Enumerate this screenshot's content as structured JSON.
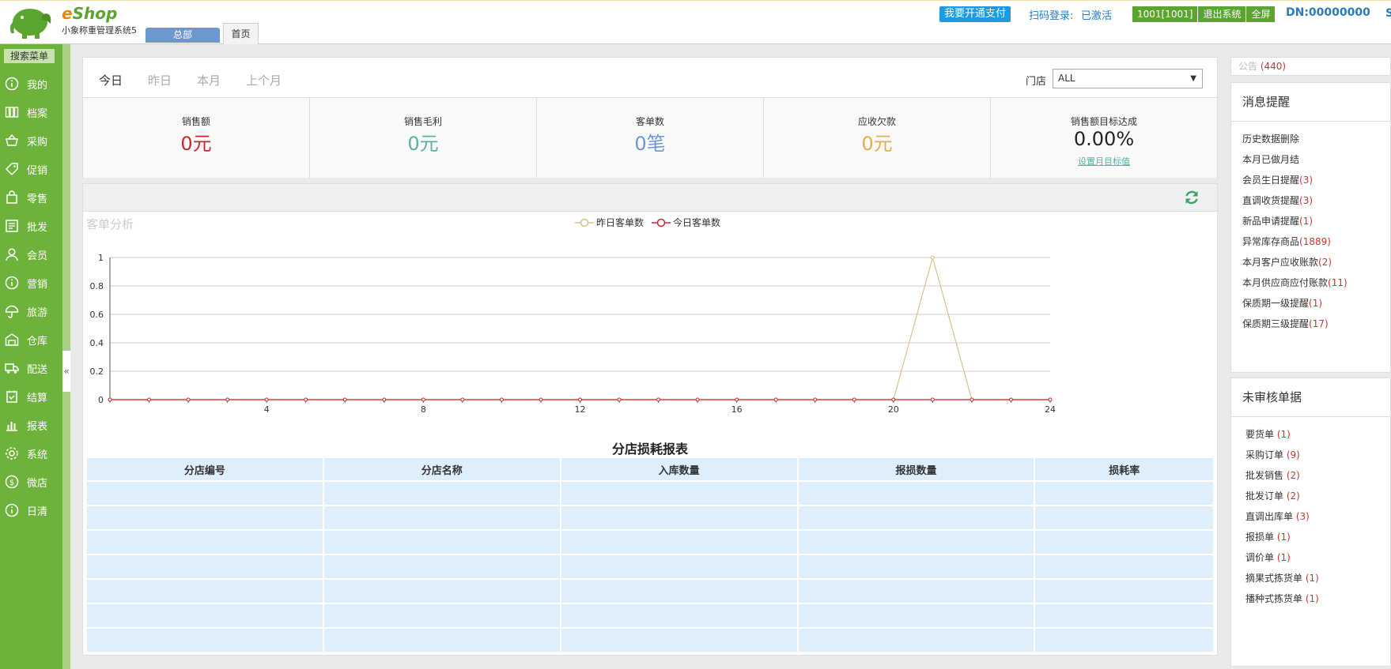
{
  "header": {
    "brand_e": "e",
    "brand_rest": "Shop",
    "subtitle": "小象称重管理系统5",
    "hq_button": "总部",
    "home_tab": "首页",
    "pay_button": "我要开通支付",
    "scan_label": "扫码登录:",
    "scan_status": "已激活",
    "user": "1001[1001]",
    "logout": "退出系统",
    "fullscreen": "全屏",
    "dn": "DN:00000000",
    "edge_char": "S"
  },
  "sidebar": {
    "search_menu": "搜索菜单",
    "collapse": "«",
    "items": [
      {
        "label": "我的",
        "icon": "info-icon"
      },
      {
        "label": "档案",
        "icon": "archive-icon"
      },
      {
        "label": "采购",
        "icon": "basket-icon"
      },
      {
        "label": "促销",
        "icon": "tag-icon"
      },
      {
        "label": "零售",
        "icon": "bag-icon"
      },
      {
        "label": "批发",
        "icon": "wholesale-icon"
      },
      {
        "label": "会员",
        "icon": "user-icon"
      },
      {
        "label": "营销",
        "icon": "info-icon"
      },
      {
        "label": "旅游",
        "icon": "umbrella-icon"
      },
      {
        "label": "仓库",
        "icon": "warehouse-icon"
      },
      {
        "label": "配送",
        "icon": "truck-icon"
      },
      {
        "label": "结算",
        "icon": "settle-icon"
      },
      {
        "label": "报表",
        "icon": "chart-icon"
      },
      {
        "label": "系统",
        "icon": "gear-icon"
      },
      {
        "label": "微店",
        "icon": "shop-icon"
      },
      {
        "label": "日清",
        "icon": "info-icon"
      }
    ]
  },
  "main": {
    "date_tabs": [
      "今日",
      "昨日",
      "本月",
      "上个月"
    ],
    "active_tab": 0,
    "store_label": "门店",
    "store_value": "ALL",
    "stats": [
      {
        "label": "销售额",
        "value": "0元",
        "color": "#c8282d"
      },
      {
        "label": "销售毛利",
        "value": "0元",
        "color": "#5cb0a0"
      },
      {
        "label": "客单数",
        "value": "0笔",
        "color": "#6c98cf"
      },
      {
        "label": "应收欠款",
        "value": "0元",
        "color": "#e0b050"
      },
      {
        "label": "销售额目标达成",
        "value": "0.00%",
        "color": "#222222",
        "link": "设置月目标值"
      }
    ]
  },
  "chart": {
    "title": "客单分析",
    "legend": [
      "昨日客单数",
      "今日客单数"
    ],
    "table_title": "分店损耗报表",
    "table_headers": [
      "分店编号",
      "分店名称",
      "入库数量",
      "报损数量",
      "损耗率"
    ],
    "empty_rows": 7
  },
  "chart_data": {
    "type": "line",
    "title": "客单分析",
    "x": [
      0,
      1,
      2,
      3,
      4,
      5,
      6,
      7,
      8,
      9,
      10,
      11,
      12,
      13,
      14,
      15,
      16,
      17,
      18,
      19,
      20,
      21,
      22,
      23,
      24
    ],
    "xticks": [
      4,
      8,
      12,
      16,
      20,
      24
    ],
    "ylim": [
      0,
      1
    ],
    "yticks": [
      0,
      0.2,
      0.4,
      0.6,
      0.8,
      1
    ],
    "grid": true,
    "legend_position": "top-center",
    "series": [
      {
        "name": "昨日客单数",
        "color": "#d9c28a",
        "values": [
          0,
          0,
          0,
          0,
          0,
          0,
          0,
          0,
          0,
          0,
          0,
          0,
          0,
          0,
          0,
          0,
          0,
          0,
          0,
          0,
          0,
          1,
          0,
          0,
          0
        ]
      },
      {
        "name": "今日客单数",
        "color": "#c8282d",
        "values": [
          0,
          0,
          0,
          0,
          0,
          0,
          0,
          0,
          0,
          0,
          0,
          0,
          0,
          0,
          0,
          0,
          0,
          0,
          0,
          0,
          0,
          0,
          0,
          0,
          0
        ]
      }
    ]
  },
  "right": {
    "notice_label": "公告",
    "notice_count": "(440)",
    "messages_title": "消息提醒",
    "messages": [
      {
        "label": "历史数据删除",
        "count": ""
      },
      {
        "label": "本月已做月结",
        "count": ""
      },
      {
        "label": "会员生日提醒",
        "count": "(3)"
      },
      {
        "label": "直调收货提醒",
        "count": "(3)"
      },
      {
        "label": "新品申请提醒",
        "count": "(1)"
      },
      {
        "label": "异常库存商品",
        "count": "(1889)"
      },
      {
        "label": "本月客户应收账款",
        "count": "(2)"
      },
      {
        "label": "本月供应商应付账款",
        "count": "(11)"
      },
      {
        "label": "保质期一级提醒",
        "count": "(1)"
      },
      {
        "label": "保质期三级提醒",
        "count": "(17)"
      }
    ],
    "todo_title": "未审核单据",
    "todos": [
      {
        "label": "要货单 ",
        "count": "(1)"
      },
      {
        "label": "采购订单 ",
        "count": "(9)"
      },
      {
        "label": "批发销售 ",
        "count": "(2)"
      },
      {
        "label": "批发订单 ",
        "count": "(2)"
      },
      {
        "label": "直调出库单  ",
        "count": "(3)"
      },
      {
        "label": "报损单  ",
        "count": "(1)"
      },
      {
        "label": "调价单 ",
        "count": "(1)"
      },
      {
        "label": "摘果式拣货单 ",
        "count": "(1)"
      },
      {
        "label": "播种式拣货单 ",
        "count": "(1)"
      }
    ]
  }
}
